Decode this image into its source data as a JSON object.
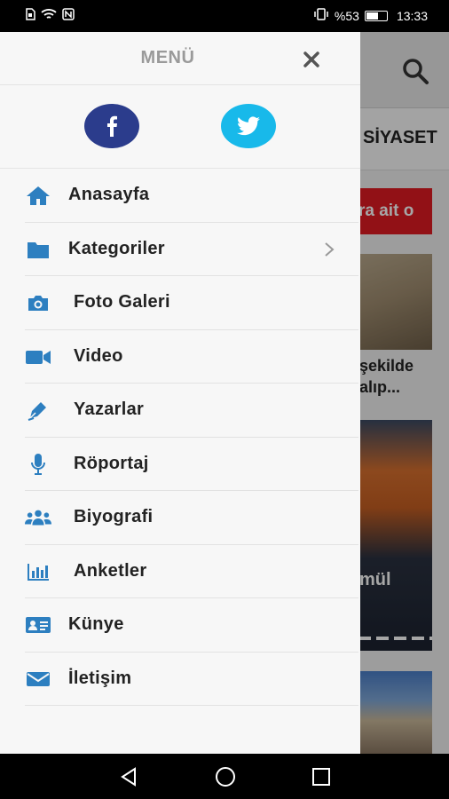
{
  "status_bar": {
    "battery_percent": "%53",
    "battery_level": 0.53,
    "time": "13:33"
  },
  "background": {
    "nav_label": "SİYASET",
    "banner_text": "ra ait o",
    "article1_text": "şekilde\nalıp...",
    "article2_text": "mül"
  },
  "drawer": {
    "title": "MENÜ",
    "menu": [
      {
        "label": "Anasayfa",
        "icon": "home-icon"
      },
      {
        "label": "Kategoriler",
        "icon": "folder-icon",
        "has_submenu": true
      },
      {
        "label": "Foto Galeri",
        "icon": "camera-icon"
      },
      {
        "label": "Video",
        "icon": "video-icon"
      },
      {
        "label": "Yazarlar",
        "icon": "pen-icon"
      },
      {
        "label": "Röportaj",
        "icon": "microphone-icon"
      },
      {
        "label": "Biyografi",
        "icon": "users-icon"
      },
      {
        "label": "Anketler",
        "icon": "bar-chart-icon"
      },
      {
        "label": "Künye",
        "icon": "id-card-icon"
      },
      {
        "label": "İletişim",
        "icon": "envelope-icon"
      }
    ]
  },
  "colors": {
    "accent_blue": "#2d7fc0",
    "facebook": "#2b3c8c",
    "twitter": "#18b9ea",
    "banner_red": "#e01b22"
  }
}
